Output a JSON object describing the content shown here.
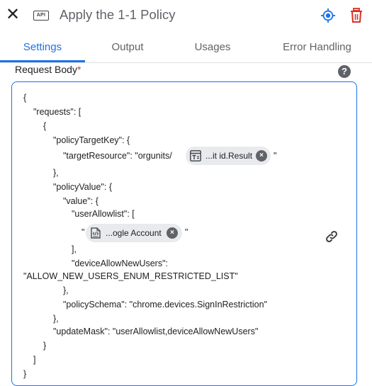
{
  "header": {
    "title": "Apply the 1-1 Policy",
    "api_badge": "API",
    "close_glyph": "✕",
    "target_icon": "target-icon",
    "delete_icon": "trash-icon",
    "accent_color": "#1a73e8",
    "delete_color": "#d93025"
  },
  "tabs": [
    {
      "label": "Settings",
      "active": true
    },
    {
      "label": "Output",
      "active": false
    },
    {
      "label": "Usages",
      "active": false
    },
    {
      "label": "Error Handling",
      "active": false
    }
  ],
  "field": {
    "label": "Request Body",
    "required_mark": "*",
    "help_glyph": "?"
  },
  "editor": {
    "lines": [
      "{",
      "\"requests\": [",
      "{",
      "\"policyTargetKey\": {",
      "\"targetResource\": \"orgunits/",
      "\"",
      "},",
      "\"policyValue\": {",
      "\"value\": {",
      "\"userAllowlist\": [",
      "\"",
      "\"",
      "],",
      "\"deviceAllowNewUsers\":",
      "\"ALLOW_NEW_USERS_ENUM_RESTRICTED_LIST\"",
      "},",
      "\"policySchema\": \"chrome.devices.SignInRestriction\"",
      "},",
      "\"updateMask\": \"userAllowlist,deviceAllowNewUsers\"",
      "}",
      "]",
      "}"
    ],
    "chips": [
      {
        "label": "...it id.Result",
        "icon": "text-field-icon",
        "remove": "×"
      },
      {
        "label": "...ogle Account",
        "icon": "code-file-icon",
        "remove": "×"
      }
    ],
    "link_icon": "link-icon"
  }
}
